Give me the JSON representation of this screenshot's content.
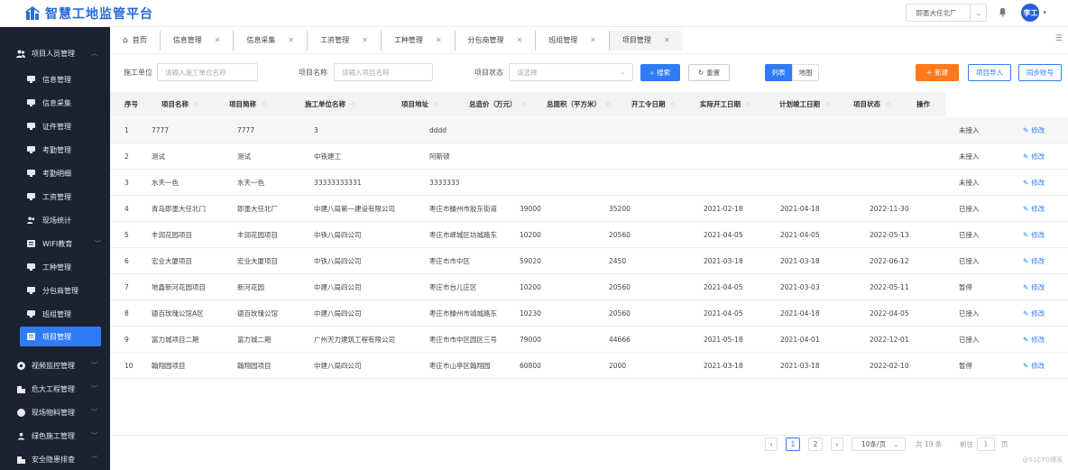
{
  "app": {
    "title": "智慧工地监管平台"
  },
  "header": {
    "company": "即墨大任北厂",
    "user_initials": "李工"
  },
  "sidebar": {
    "groups": [
      {
        "label": "项目人员管理",
        "icon": "people-icon",
        "expanded": true
      },
      {
        "label": "视频监控管理",
        "icon": "camera-icon"
      },
      {
        "label": "危大工程管理",
        "icon": "building-icon"
      },
      {
        "label": "现场物料管理",
        "icon": "box-icon"
      },
      {
        "label": "绿色施工管理",
        "icon": "leaf-icon"
      },
      {
        "label": "安全隐患排查",
        "icon": "shield-icon"
      }
    ],
    "items": [
      {
        "label": "信息管理"
      },
      {
        "label": "信息采集"
      },
      {
        "label": "证件管理"
      },
      {
        "label": "考勤管理"
      },
      {
        "label": "考勤明细"
      },
      {
        "label": "工资管理"
      },
      {
        "label": "现场统计"
      },
      {
        "label": "WIFI教育"
      },
      {
        "label": "工种管理"
      },
      {
        "label": "分包商管理"
      },
      {
        "label": "班组管理"
      },
      {
        "label": "项目管理",
        "active": true
      }
    ]
  },
  "tabs": [
    {
      "label": "首页",
      "home": true
    },
    {
      "label": "信息管理"
    },
    {
      "label": "信息采集"
    },
    {
      "label": "工资管理"
    },
    {
      "label": "工种管理"
    },
    {
      "label": "分包商管理"
    },
    {
      "label": "班组管理"
    },
    {
      "label": "项目管理",
      "active": true
    }
  ],
  "filters": {
    "unit_label": "施工单位",
    "unit_placeholder": "请输入施工单位名称",
    "name_label": "项目名称",
    "name_placeholder": "请输入项目名称",
    "status_label": "项目状态",
    "status_placeholder": "请选择",
    "search": "搜索",
    "reset": "重置",
    "view_list": "列表",
    "view_map": "地图",
    "new": "新建",
    "import": "项目导入",
    "sync": "同步账号"
  },
  "table": {
    "columns": [
      "序号",
      "项目名称",
      "项目简称",
      "施工单位名称",
      "项目地址",
      "总造价（万元）",
      "总面积（平方米）",
      "开工令日期",
      "实际开工日期",
      "计划竣工日期",
      "项目状态",
      "操作"
    ],
    "edit_label": "修改",
    "rows": [
      [
        "1",
        "7777",
        "7777",
        "3",
        "dddd",
        "",
        "",
        "",
        "",
        "",
        "未接入"
      ],
      [
        "2",
        "测试",
        "测试",
        "中铁建工",
        "阿斯顿",
        "",
        "",
        "",
        "",
        "",
        "未接入"
      ],
      [
        "3",
        "水天一色",
        "水天一色",
        "33333333331",
        "3333333",
        "",
        "",
        "",
        "",
        "",
        "未接入"
      ],
      [
        "4",
        "青岛即墨大任北门",
        "即墨大任北厂",
        "中建八局第一建设有限公司",
        "枣庄市滕州市胶东街道",
        "39000",
        "35200",
        "2021-02-18",
        "2021-04-18",
        "2022-11-30",
        "已接入"
      ],
      [
        "5",
        "丰润花园项目",
        "丰润花园项目",
        "中铁八局四公司",
        "枣庄市峄城区坊城路东",
        "10200",
        "20560",
        "2021-04-05",
        "2021-04-05",
        "2022-05-13",
        "已接入"
      ],
      [
        "6",
        "宏业大厦项目",
        "宏业大厦项目",
        "中铁八局四公司",
        "枣庄市市中区",
        "59020",
        "2450",
        "2021-03-18",
        "2021-03-18",
        "2022-06-12",
        "已接入"
      ],
      [
        "7",
        "地鑫新河花园项目",
        "新河花园",
        "中建八局四公司",
        "枣庄市台儿庄区",
        "10200",
        "20560",
        "2021-04-05",
        "2021-03-03",
        "2022-05-11",
        "暂停"
      ],
      [
        "8",
        "德百玫瑰公馆A区",
        "德百玫瑰公馆",
        "中建八局四公司",
        "枣庄市滕州市靖城路东",
        "10230",
        "20560",
        "2021-04-05",
        "2021-04-18",
        "2022-04-05",
        "已接入"
      ],
      [
        "9",
        "富力城项目二期",
        "富力城二期",
        "广州天力建筑工程有限公司",
        "枣庄市市中区园区三号",
        "79000",
        "44666",
        "2021-05-18",
        "2021-04-01",
        "2022-12-01",
        "已接入"
      ],
      [
        "10",
        "翰翔园项目",
        "翰翔园项目",
        "中建八局四公司",
        "枣庄市山亭区翰翔园",
        "60800",
        "2000",
        "2021-03-18",
        "2021-03-18",
        "2022-02-10",
        "暂停"
      ]
    ]
  },
  "pagination": {
    "prev": "‹",
    "page1": "1",
    "page2": "2",
    "next": "›",
    "size": "10条/页",
    "total": "共 19 条",
    "goto": "前往",
    "goto_value": "1",
    "page_suffix": "页"
  },
  "watermark": "@51CTO博客"
}
